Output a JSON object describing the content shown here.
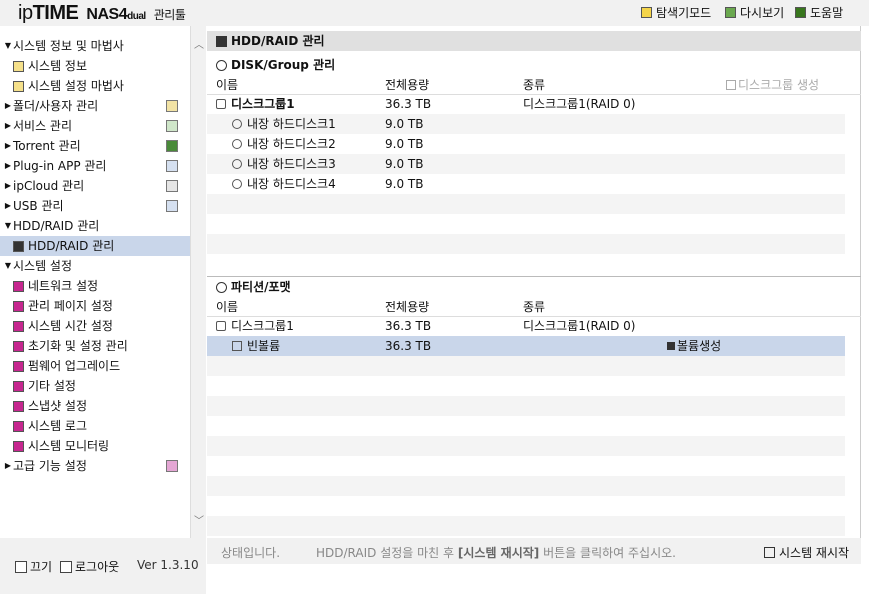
{
  "header": {
    "logo_ip": "ip",
    "logo_time": "TIME",
    "logo_model": "NAS4",
    "logo_model_suffix": "dual",
    "logo_tool": "관리툴",
    "explore_mode": "탐색기모드",
    "refresh": "다시보기",
    "help": "도움말"
  },
  "sidebar": {
    "items": [
      {
        "label": "시스템 정보 및 마법사"
      },
      {
        "label": "시스템 정보"
      },
      {
        "label": "시스템 설정 마법사"
      },
      {
        "label": "폴더/사용자 관리"
      },
      {
        "label": "서비스 관리"
      },
      {
        "label": "Torrent 관리"
      },
      {
        "label": "Plug-in APP 관리"
      },
      {
        "label": "ipCloud 관리"
      },
      {
        "label": "USB 관리"
      },
      {
        "label": "HDD/RAID 관리"
      },
      {
        "label": "HDD/RAID 관리"
      },
      {
        "label": "시스템 설정"
      },
      {
        "label": "네트워크 설정"
      },
      {
        "label": "관리 페이지 설정"
      },
      {
        "label": "시스템 시간 설정"
      },
      {
        "label": "초기화 및 설정 관리"
      },
      {
        "label": "펌웨어 업그레이드"
      },
      {
        "label": "기타 설정"
      },
      {
        "label": "스냅샷 설정"
      },
      {
        "label": "시스템 로그"
      },
      {
        "label": "시스템 모니터링"
      },
      {
        "label": "고급 기능 설정"
      }
    ],
    "footer": {
      "off": "끄기",
      "logout": "로그아웃",
      "version": "Ver 1.3.10"
    }
  },
  "main": {
    "title": "HDD/RAID 관리",
    "disk_section": {
      "title": "DISK/Group 관리",
      "columns": [
        "이름",
        "전체용량",
        "종류"
      ],
      "create_group": "디스크그룹 생성",
      "rows": [
        {
          "name": "디스크그룹1",
          "capacity": "36.3 TB",
          "type": "디스크그룹1(RAID 0)"
        },
        {
          "name": "내장 하드디스크1",
          "capacity": "9.0 TB",
          "type": ""
        },
        {
          "name": "내장 하드디스크2",
          "capacity": "9.0 TB",
          "type": ""
        },
        {
          "name": "내장 하드디스크3",
          "capacity": "9.0 TB",
          "type": ""
        },
        {
          "name": "내장 하드디스크4",
          "capacity": "9.0 TB",
          "type": ""
        }
      ]
    },
    "partition_section": {
      "title": "파티션/포맷",
      "columns": [
        "이름",
        "전체용량",
        "종류"
      ],
      "rows": [
        {
          "name": "디스크그룹1",
          "capacity": "36.3 TB",
          "type": "디스크그룹1(RAID 0)"
        },
        {
          "name": "빈볼륨",
          "capacity": "36.3 TB",
          "type": ""
        }
      ],
      "create_volume": "볼륨생성"
    }
  },
  "status": {
    "label": "상태입니다.",
    "message_pre": "HDD/RAID 설정을 마친 후 ",
    "message_bold": "[시스템 재시작]",
    "message_post": " 버튼을 클릭하여 주십시오.",
    "restart": "시스템 재시작"
  }
}
